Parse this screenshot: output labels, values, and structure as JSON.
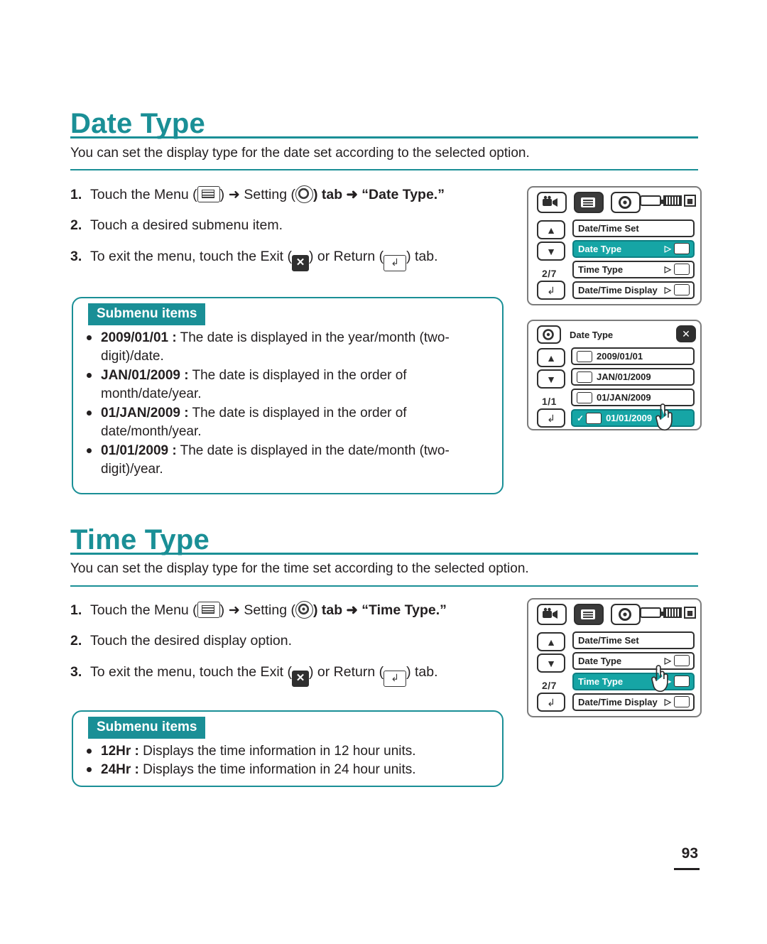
{
  "page": {
    "number": "93"
  },
  "sections": [
    {
      "title": "Date Type",
      "intro": "You can set the display type for the date set according to the selected option.",
      "steps": [
        {
          "num": "1.",
          "pre": "Touch the Menu (",
          "mid": ") ➜ Setting (",
          "post": ") tab ➜ “Date Type.”"
        },
        {
          "num": "2.",
          "text": "Touch a desired submenu item."
        },
        {
          "num": "3.",
          "pre": "To exit the menu, touch the Exit (",
          "mid": ") or Return (",
          "post": ") tab."
        }
      ],
      "submenu_label": "Submenu items",
      "submenu_items": [
        {
          "term": "2009/01/01 :",
          "desc": " The date is displayed in the year/month (two-digit)/date."
        },
        {
          "term": "JAN/01/2009 :",
          "desc": " The date is displayed in the order of month/date/year."
        },
        {
          "term": "01/JAN/2009 :",
          "desc": " The date is displayed in the order of date/month/year."
        },
        {
          "term": "01/01/2009 :",
          "desc": " The date is displayed in the date/month (two-digit)/year."
        }
      ]
    },
    {
      "title": "Time Type",
      "intro": "You can set the display type for the time set according to the selected option.",
      "steps": [
        {
          "num": "1.",
          "pre": "Touch the Menu (",
          "mid": ") ➜ Setting (",
          "post": ") tab ➜ “Time Type.”"
        },
        {
          "num": "2.",
          "text": "Touch the desired display option."
        },
        {
          "num": "3.",
          "pre": "To exit the menu, touch the Exit (",
          "mid": ") or Return (",
          "post": ") tab."
        }
      ],
      "submenu_label": "Submenu items",
      "submenu_items": [
        {
          "term": "12Hr :",
          "desc": " Displays the time information in 12 hour units."
        },
        {
          "term": "24Hr :",
          "desc": " Displays the time information in 24 hour units."
        }
      ]
    }
  ],
  "screens": {
    "date_menu": {
      "page_indicator": "2/7",
      "rows": [
        {
          "label": "Date/Time Set",
          "selected": false,
          "arrow": ""
        },
        {
          "label": "Date Type",
          "selected": true,
          "arrow": "▷"
        },
        {
          "label": "Time Type",
          "selected": false,
          "arrow": "▷"
        },
        {
          "label": "Date/Time Display",
          "selected": false,
          "arrow": "▷"
        }
      ]
    },
    "date_dialog": {
      "title": "Date Type",
      "page_indicator": "1/1",
      "rows": [
        {
          "label": "2009/01/01",
          "selected": false
        },
        {
          "label": "JAN/01/2009",
          "selected": false
        },
        {
          "label": "01/JAN/2009",
          "selected": false
        },
        {
          "label": "01/01/2009",
          "selected": true
        }
      ]
    },
    "time_menu": {
      "page_indicator": "2/7",
      "rows": [
        {
          "label": "Date/Time Set",
          "selected": false,
          "arrow": ""
        },
        {
          "label": "Date Type",
          "selected": false,
          "arrow": "▷"
        },
        {
          "label": "Time Type",
          "selected": true,
          "arrow": "▶"
        },
        {
          "label": "Date/Time Display",
          "selected": false,
          "arrow": "▷"
        }
      ]
    }
  },
  "colors": {
    "accent": "#1a8f96",
    "highlight": "#16a5a5",
    "text": "#231f20"
  }
}
